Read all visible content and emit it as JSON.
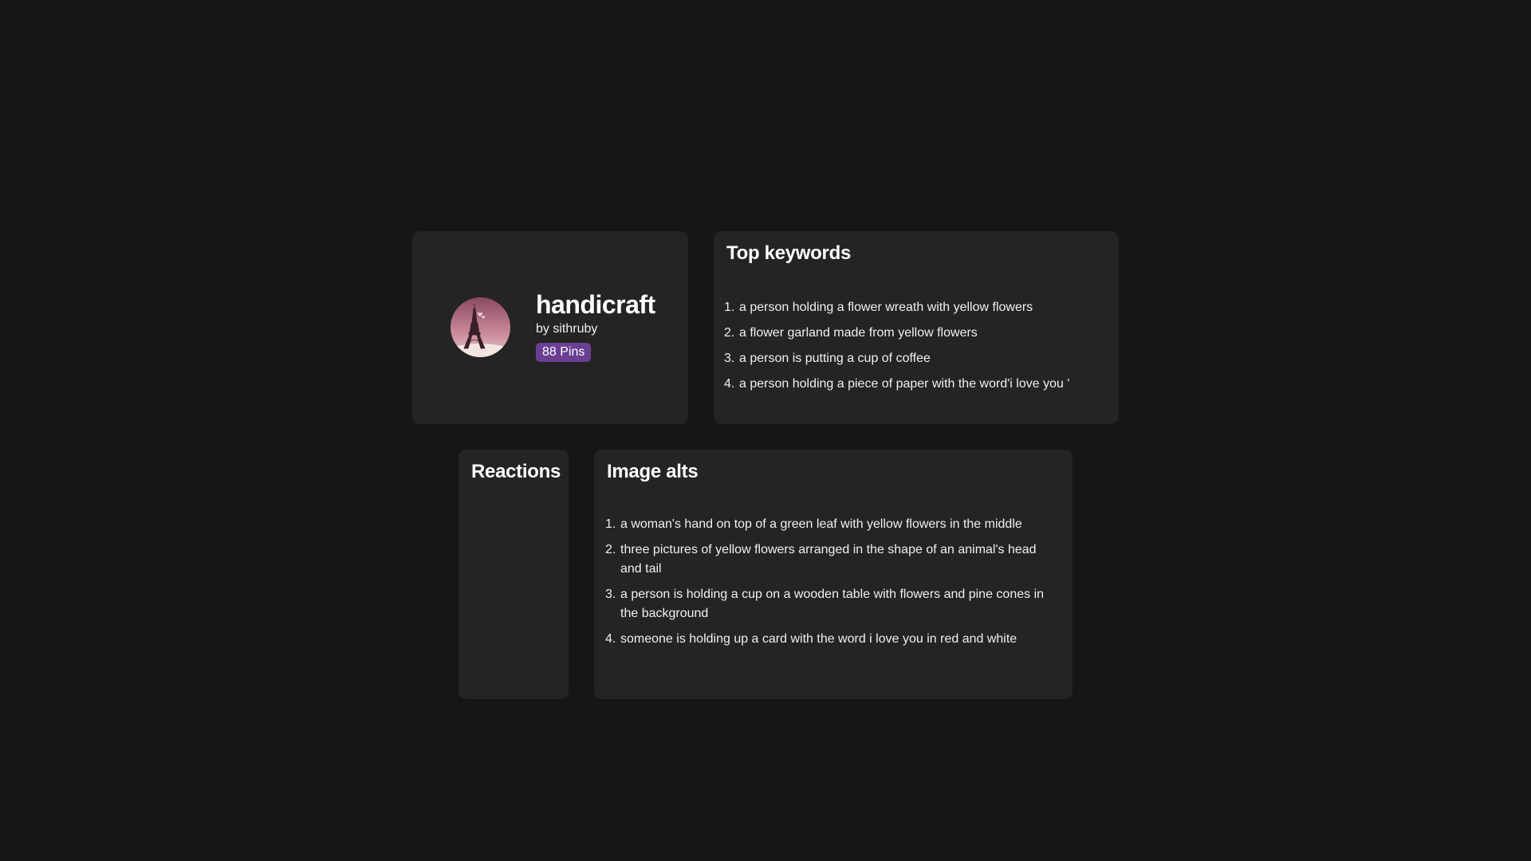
{
  "board": {
    "title": "handicraft",
    "owner": "by sithruby",
    "pins": "88 Pins",
    "avatar_icon": "eiffel-tower-avatar"
  },
  "keywords": {
    "heading": "Top keywords",
    "items": [
      {
        "num": "1.",
        "text": "a person holding a flower wreath with yellow flowers"
      },
      {
        "num": "2.",
        "text": "a flower garland made from yellow flowers"
      },
      {
        "num": "3.",
        "text": "a person is putting a cup of coffee"
      },
      {
        "num": "4.",
        "text": "a person holding a piece of paper with the word'i love you '"
      }
    ]
  },
  "reactions": {
    "heading": "Reactions"
  },
  "alts": {
    "heading": "Image alts",
    "items": [
      {
        "num": "1.",
        "text": "a woman's hand on top of a green leaf with yellow flowers in the middle"
      },
      {
        "num": "2.",
        "text": "three pictures of yellow flowers arranged in the shape of an animal's head and tail"
      },
      {
        "num": "3.",
        "text": "a person is holding a cup on a wooden table with flowers and pine cones in the background"
      },
      {
        "num": "4.",
        "text": "someone is holding up a card with the word i love you in red and white"
      }
    ]
  },
  "colors": {
    "background": "#161616",
    "card": "#242424",
    "badge": "#6a3f93"
  }
}
